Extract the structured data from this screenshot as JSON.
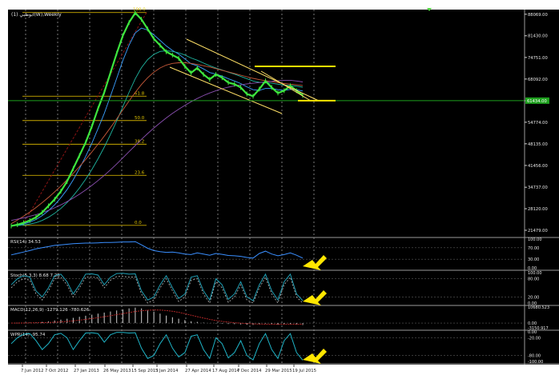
{
  "chart_data": {
    "type": "candlestick",
    "symbol_label": "ابوظبي (1)(W),Weekly",
    "x_dates": [
      "7 Jun 2012",
      "7 Oct 2012",
      "27 Jan 2013",
      "26 May 2013",
      "15 Sep 2013",
      "5 Jan 2014",
      "27 Apr 2014",
      "17 Aug 2014",
      "7 Dec 2014",
      "29 Mar 2015",
      "19 Jul 2015"
    ],
    "y_ticks": [
      "88069.00",
      "81430.00",
      "74751.00",
      "68092.00",
      "61413.00",
      "54774.00",
      "48135.00",
      "41456.00",
      "34737.00",
      "28120.00",
      "21479.00"
    ],
    "last_price_label": "61434.00",
    "fibonacci": [
      {
        "label": "100.0",
        "value": 88600
      },
      {
        "label": "61.8",
        "value": 62800
      },
      {
        "label": "50.0",
        "value": 55300
      },
      {
        "label": "38.2",
        "value": 48000
      },
      {
        "label": "23.6",
        "value": 38400
      },
      {
        "label": "0.0",
        "value": 23000
      }
    ],
    "price_series": [
      22800,
      23200,
      23800,
      24500,
      25500,
      27000,
      29000,
      31000,
      33500,
      36500,
      40500,
      44500,
      48500,
      53500,
      59000,
      64000,
      70000,
      76000,
      81500,
      85500,
      88500,
      86500,
      83500,
      80500,
      78500,
      76500,
      75500,
      74500,
      72000,
      70000,
      71500,
      69500,
      68000,
      69500,
      68500,
      67000,
      66500,
      65500,
      63500,
      62800,
      65000,
      67500,
      65500,
      63800,
      64500,
      66000,
      64500,
      63000
    ],
    "ma_series": [
      {
        "color": "#3aa0ff",
        "values": [
          22800,
          23000,
          23400,
          24000,
          24800,
          26000,
          27500,
          29300,
          31500,
          34000,
          37000,
          40500,
          44200,
          48300,
          52800,
          57500,
          62800,
          68300,
          73800,
          78500,
          82300,
          83800,
          83200,
          81700,
          80000,
          78300,
          76900,
          75800,
          74300,
          72800,
          72200,
          71200,
          70100,
          69600,
          69000,
          68200,
          67500,
          66700,
          65700,
          64800,
          64600,
          65200,
          65200,
          64800,
          64600,
          64900,
          64800,
          64400
        ]
      },
      {
        "color": "#1fb5a0",
        "values": [
          22900,
          22950,
          23100,
          23400,
          23800,
          24500,
          25500,
          26700,
          28200,
          30000,
          32100,
          34500,
          37200,
          40200,
          43500,
          47100,
          51000,
          55200,
          59600,
          64000,
          68200,
          71600,
          74100,
          75700,
          76600,
          76800,
          76600,
          76200,
          75500,
          74600,
          73900,
          73000,
          72200,
          71500,
          70900,
          70200,
          69600,
          68900,
          68200,
          67500,
          67100,
          67000,
          66800,
          66500,
          66200,
          66100,
          65900,
          65600
        ]
      },
      {
        "color": "#c85a3a",
        "values": [
          23500,
          24600,
          25800,
          27100,
          28500,
          30000,
          31600,
          33300,
          35100,
          37000,
          39000,
          41100,
          43300,
          45600,
          48000,
          50500,
          53100,
          55800,
          58600,
          61300,
          64000,
          66400,
          68500,
          70200,
          71500,
          72400,
          72900,
          73100,
          73100,
          72900,
          72600,
          72200,
          71800,
          71300,
          70800,
          70300,
          69800,
          69300,
          68800,
          68300,
          67900,
          67600,
          67300,
          67000,
          66700,
          66500,
          66300,
          66100
        ]
      },
      {
        "color": "#8a4fb0",
        "values": [
          24500,
          24900,
          25300,
          25800,
          26300,
          26900,
          27600,
          28400,
          29300,
          30300,
          31400,
          32600,
          33900,
          35300,
          36800,
          38400,
          40100,
          41900,
          43800,
          45700,
          47600,
          49500,
          51300,
          53000,
          54600,
          56100,
          57500,
          58800,
          60000,
          61100,
          62100,
          63000,
          63800,
          64500,
          65100,
          65600,
          66000,
          66300,
          66600,
          66800,
          67000,
          67200,
          67400,
          67600,
          67700,
          67700,
          67500,
          67200
        ]
      }
    ],
    "channel_annotation": {
      "color": "#ffe066"
    },
    "horizontal_levels": [
      {
        "value": 72000,
        "color": "#ffe600"
      },
      {
        "value": 61434,
        "color": "#ffe600"
      },
      {
        "value": 61434,
        "color": "#1ea01e"
      }
    ],
    "indicators": [
      {
        "name": "RSI(14) 34.53",
        "ticks": [
          "100.00",
          "70.00",
          "30.00",
          "0.00"
        ],
        "range": [
          0,
          100
        ],
        "values": [
          45,
          50,
          55,
          60,
          66,
          70,
          74,
          78,
          80,
          82,
          84,
          85,
          86,
          86,
          87,
          88,
          88,
          89,
          90,
          90,
          91,
          80,
          68,
          60,
          56,
          54,
          55,
          52,
          48,
          46,
          52,
          48,
          44,
          50,
          47,
          43,
          42,
          40,
          36,
          34,
          50,
          58,
          48,
          42,
          46,
          52,
          44,
          34
        ]
      },
      {
        "name": "Stoch(5,3,3) 8.68 7.28",
        "ticks": [
          "100.00",
          "80.00",
          "20.00",
          "0.00"
        ],
        "range": [
          0,
          100
        ],
        "values": [
          60,
          80,
          90,
          85,
          40,
          20,
          50,
          90,
          95,
          70,
          30,
          60,
          95,
          96,
          92,
          60,
          85,
          97,
          98,
          95,
          96,
          40,
          10,
          20,
          60,
          90,
          50,
          15,
          30,
          85,
          90,
          40,
          10,
          80,
          60,
          12,
          30,
          70,
          20,
          8,
          60,
          95,
          40,
          10,
          70,
          95,
          30,
          8
        ]
      },
      {
        "name": "MACD(12,26,9) -1279.126 -780.626",
        "ticks": [
          "10680.523",
          "0.00",
          "-3150.917"
        ],
        "range": [
          -3150.917,
          10680.523
        ],
        "values": [
          0,
          50,
          150,
          300,
          500,
          800,
          1200,
          1700,
          2300,
          2900,
          3500,
          4200,
          4900,
          5600,
          6300,
          7000,
          7700,
          8400,
          9100,
          9800,
          10300,
          9800,
          8800,
          7600,
          6300,
          5000,
          3900,
          2900,
          2000,
          1200,
          800,
          300,
          -100,
          -200,
          -400,
          -600,
          -700,
          -900,
          -1100,
          -1200,
          -800,
          -300,
          -500,
          -900,
          -800,
          -600,
          -900,
          -1279
        ]
      },
      {
        "name": "WPR(14) -95.74",
        "ticks": [
          "0.00",
          "-20.00",
          "-80.00",
          "-100.00"
        ],
        "range": [
          -100,
          0
        ],
        "values": [
          -40,
          -20,
          -8,
          -6,
          -30,
          -60,
          -40,
          -10,
          -5,
          -20,
          -60,
          -30,
          -4,
          -3,
          -6,
          -35,
          -10,
          -2,
          -2,
          -4,
          -3,
          -55,
          -90,
          -80,
          -40,
          -10,
          -55,
          -85,
          -70,
          -15,
          -10,
          -60,
          -90,
          -20,
          -40,
          -88,
          -70,
          -30,
          -80,
          -95,
          -40,
          -6,
          -60,
          -90,
          -30,
          -6,
          -70,
          -95.74
        ]
      }
    ]
  }
}
